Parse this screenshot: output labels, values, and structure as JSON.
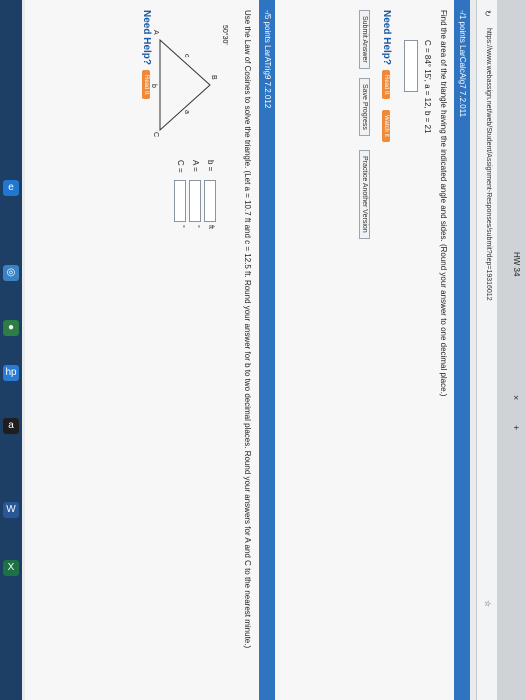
{
  "browser": {
    "tab_title": "HW 34",
    "url": "https://www.webassign.net/web/Student/Assignment-Responses/submit?dep=19316012"
  },
  "question1": {
    "header": "-/1 points LarCalcAlg7 7.2.011",
    "prompt": "Find the area of the triangle having the indicated angle and sides. (Round your answer to one decimal place.)",
    "given": "C = 84° 15',  a = 12,  b = 21",
    "need_help": "Need Help?",
    "read_it": "Read It",
    "watch_it": "Watch It",
    "submit": "Submit Answer",
    "save": "Save Progress",
    "practice": "Practice Another Version"
  },
  "question2": {
    "header": "-/5 points LarATrig9 7.2.012",
    "prompt": "Use the Law of Cosines to solve the triangle. (Let a = 10.7 ft and c = 12.5 ft. Round your answer for b to two decimal places. Round your answers for A and C to the nearest minute.)",
    "angle_label": "50°30'",
    "vertex_B": "B",
    "vertex_A": "A",
    "vertex_C": "C",
    "side_a": "a",
    "side_b": "b",
    "side_c": "c",
    "b_label": "b =",
    "A_label": "A =",
    "C_label": "C =",
    "unit_ft": "ft",
    "unit_deg": "°",
    "need_help": "Need Help?",
    "read_it": "Read It"
  },
  "taskbar_icons": [
    "edge-icon",
    "windows-icon",
    "chrome-icon",
    "hp-icon",
    "amazon-icon",
    "word-icon",
    "excel-icon"
  ]
}
